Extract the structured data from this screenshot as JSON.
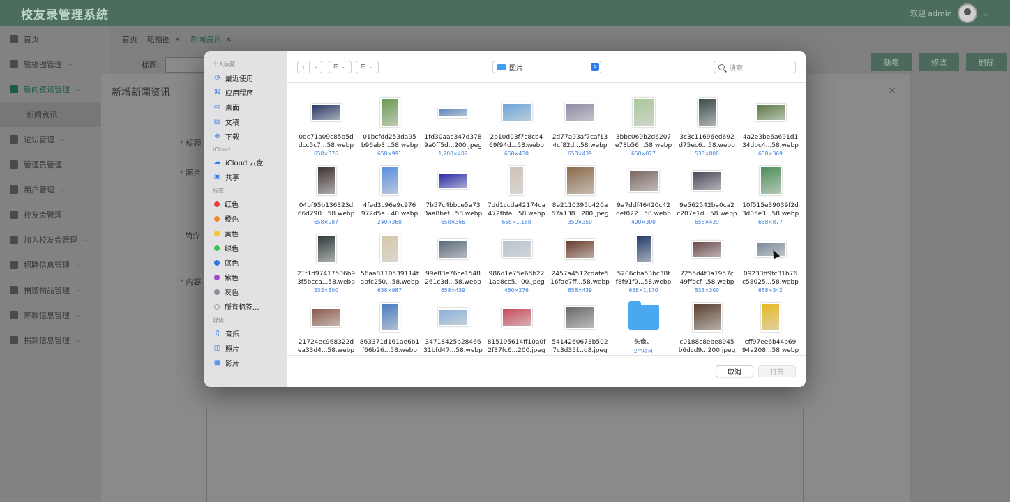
{
  "app": {
    "title": "校友录管理系统",
    "welcome": "欢迎 admin"
  },
  "sidebar": {
    "items": [
      {
        "label": "首页",
        "arrow": ""
      },
      {
        "label": "轮播图管理",
        "arrow": "⌄"
      },
      {
        "label": "新闻资讯管理",
        "arrow": "⌄",
        "active": true
      },
      {
        "label": "新闻资讯",
        "sub": true
      },
      {
        "label": "论坛管理",
        "arrow": "⌄"
      },
      {
        "label": "管理员管理",
        "arrow": "⌄"
      },
      {
        "label": "用户管理",
        "arrow": "⌄"
      },
      {
        "label": "校友会管理",
        "arrow": "⌄"
      },
      {
        "label": "加入校友会管理",
        "arrow": "⌄"
      },
      {
        "label": "招聘信息管理",
        "arrow": "⌄"
      },
      {
        "label": "捐赠物品管理",
        "arrow": "⌄"
      },
      {
        "label": "筹款信息管理",
        "arrow": "⌄"
      },
      {
        "label": "捐款信息管理",
        "arrow": "⌄"
      }
    ]
  },
  "tabs": [
    {
      "label": "首页"
    },
    {
      "label": "轮播图"
    },
    {
      "label": "新闻资讯",
      "active": true
    }
  ],
  "filter": {
    "label": "标题:",
    "placeholder": "标题"
  },
  "actions": {
    "add": "新增",
    "edit": "修改",
    "delete": "删除"
  },
  "form": {
    "title": "新增新闻资讯",
    "fields": {
      "title": "标题",
      "image": "图片",
      "intro": "简介",
      "content": "内容"
    },
    "close": "×"
  },
  "finder": {
    "sidebar": {
      "favorites_head": "个人收藏",
      "favorites": [
        {
          "label": "最近使用",
          "icon": "clock-icon",
          "glyph": "◷"
        },
        {
          "label": "应用程序",
          "icon": "apps-icon",
          "glyph": "⌘"
        },
        {
          "label": "桌面",
          "icon": "desktop-icon",
          "glyph": "▭"
        },
        {
          "label": "文稿",
          "icon": "document-icon",
          "glyph": "▤"
        },
        {
          "label": "下载",
          "icon": "download-icon",
          "glyph": "⊕"
        }
      ],
      "icloud_head": "iCloud",
      "icloud": [
        {
          "label": "iCloud 云盘",
          "icon": "cloud-icon",
          "glyph": "☁"
        },
        {
          "label": "共享",
          "icon": "shared-folder-icon",
          "glyph": "▣"
        }
      ],
      "tags_head": "标签",
      "tags": [
        {
          "label": "红色",
          "color": "#e8403a"
        },
        {
          "label": "橙色",
          "color": "#f08a24"
        },
        {
          "label": "黄色",
          "color": "#f4c52d"
        },
        {
          "label": "绿色",
          "color": "#3cc24c"
        },
        {
          "label": "蓝色",
          "color": "#2e76e8"
        },
        {
          "label": "紫色",
          "color": "#9a4ac9"
        },
        {
          "label": "灰色",
          "color": "#8e8e92"
        },
        {
          "label": "所有标签...",
          "color": ""
        }
      ],
      "media_head": "媒体",
      "media": [
        {
          "label": "音乐",
          "icon": "music-icon",
          "glyph": "♫"
        },
        {
          "label": "照片",
          "icon": "photo-icon",
          "glyph": "◫"
        },
        {
          "label": "影片",
          "icon": "movie-icon",
          "glyph": "▦"
        }
      ]
    },
    "location": "图片",
    "search_placeholder": "搜索",
    "buttons": {
      "cancel": "取消",
      "open": "打开"
    },
    "files": [
      {
        "line1": "0dc71a09c85b5d",
        "line2": "dcc5c7...58.webp",
        "dim": "658×376",
        "color": "#2a3a66",
        "ar": 1.75
      },
      {
        "line1": "01bcfdd253da95",
        "line2": "b96ab3...58.webp",
        "dim": "658×991",
        "color": "#6a9a4f",
        "ar": 0.66
      },
      {
        "line1": "1fd30aac347d378",
        "line2": "9a0ff5d...200.jpeg",
        "dim": "1,200×402",
        "color": "#5d86c0",
        "ar": 2.98
      },
      {
        "line1": "2b10d03f7c8cb4",
        "line2": "69f94d...58.webp",
        "dim": "658×430",
        "color": "#6aa6d8",
        "ar": 1.53
      },
      {
        "line1": "2d77a93af7caf13",
        "line2": "4cf82d...58.webp",
        "dim": "658×439",
        "color": "#8d8aa6",
        "ar": 1.5
      },
      {
        "line1": "3bbc069b2d6207",
        "line2": "e78b56...58.webp",
        "dim": "658×877",
        "color": "#a8c79a",
        "ar": 0.75
      },
      {
        "line1": "3c3c11696ed692",
        "line2": "d75ec6...58.webp",
        "dim": "533×800",
        "color": "#3a4a4a",
        "ar": 0.67
      },
      {
        "line1": "4a2e3be6a691d1",
        "line2": "34dbc4...58.webp",
        "dim": "658×369",
        "color": "#5b7b45",
        "ar": 1.78
      },
      {
        "line1": "04bf95b136323d",
        "line2": "66d290...58.webp",
        "dim": "658×987",
        "color": "#3e3232",
        "ar": 0.67
      },
      {
        "line1": "4fed3c96e9c976",
        "line2": "972d5a...40.webp",
        "dim": "240×360",
        "color": "#5b8fe0",
        "ar": 0.67
      },
      {
        "line1": "7b57c4bbce5a73",
        "line2": "3aa8bef...58.webp",
        "dim": "658×366",
        "color": "#2a28a8",
        "ar": 1.8
      },
      {
        "line1": "7dd1ccda42174ca",
        "line2": "472fbfa...58.webp",
        "dim": "658×1,188",
        "color": "#cfc3b8",
        "ar": 0.55
      },
      {
        "line1": "8e2110395b420a",
        "line2": "67a138...200.jpeg",
        "dim": "350×350",
        "color": "#8a6a4a",
        "ar": 1.0
      },
      {
        "line1": "9a7ddf46420c42",
        "line2": "def022...58.webp",
        "dim": "400×300",
        "color": "#7a6660",
        "ar": 1.33
      },
      {
        "line1": "9e562542ba0ca2",
        "line2": "c207e1d...58.webp",
        "dim": "658×439",
        "color": "#4a4a5a",
        "ar": 1.5
      },
      {
        "line1": "10f515e39039f2d",
        "line2": "3d05e3...58.webp",
        "dim": "658×877",
        "color": "#4e8e5a",
        "ar": 0.75
      },
      {
        "line1": "21f1d97417506b9",
        "line2": "3f5bcca...58.webp",
        "dim": "533×800",
        "color": "#2e3a3a",
        "ar": 0.67
      },
      {
        "line1": "56aa8110539114f",
        "line2": "abfc250...58.webp",
        "dim": "658×987",
        "color": "#d6c8a8",
        "ar": 0.67
      },
      {
        "line1": "99e83e76ce1548",
        "line2": "261c3d...58.webp",
        "dim": "658×439",
        "color": "#5a6a7a",
        "ar": 1.5
      },
      {
        "line1": "986d1e75e65b22",
        "line2": "1ae8cc5...00.jpeg",
        "dim": "460×276",
        "color": "#b8c4d0",
        "ar": 1.67
      },
      {
        "line1": "2457a4512cdafe5",
        "line2": "16fae7ff...58.webp",
        "dim": "658×439",
        "color": "#6a3a2a",
        "ar": 1.5
      },
      {
        "line1": "5206cba53bc38f",
        "line2": "f8f91f9...58.webp",
        "dim": "658×1,170",
        "color": "#1f3a66",
        "ar": 0.56
      },
      {
        "line1": "7255d4f3a1957c",
        "line2": "49ffbcf...58.webp",
        "dim": "533×300",
        "color": "#6a4a4a",
        "ar": 1.78
      },
      {
        "line1": "09233ff9fc31b76",
        "line2": "c58025...58.webp",
        "dim": "658×342",
        "color": "#7a8a9a",
        "ar": 1.92
      },
      {
        "line1": "21724ec968322d",
        "line2": "ea33d4...58.webp",
        "dim": "",
        "color": "#8a5a4a",
        "ar": 1.6
      },
      {
        "line1": "863371d161ae6b1",
        "line2": "f66b26...58.webp",
        "dim": "",
        "color": "#4a7ac0",
        "ar": 0.67
      },
      {
        "line1": "34718425b28466",
        "line2": "31bfd47...58.webp",
        "dim": "",
        "color": "#8ab0d8",
        "ar": 1.7
      },
      {
        "line1": "815195614ff10a0f",
        "line2": "2f37fc6...200.jpeg",
        "dim": "",
        "color": "#c84a5a",
        "ar": 1.5
      },
      {
        "line1": "5414260673b502",
        "line2": "7c3d35f...g8.jpeg",
        "dim": "",
        "color": "#6a6a6a",
        "ar": 1.33
      },
      {
        "line1": "头像、",
        "line2": "",
        "dim": "2个项目",
        "folder": true
      },
      {
        "line1": "c0188c8ebe8945",
        "line2": "b6dcd9...200.jpeg",
        "dim": "",
        "color": "#5a4030",
        "ar": 1.0
      },
      {
        "line1": "cff97ee6b44b69",
        "line2": "94a208...58.webp",
        "dim": "",
        "color": "#e6b820",
        "ar": 0.67
      }
    ]
  }
}
